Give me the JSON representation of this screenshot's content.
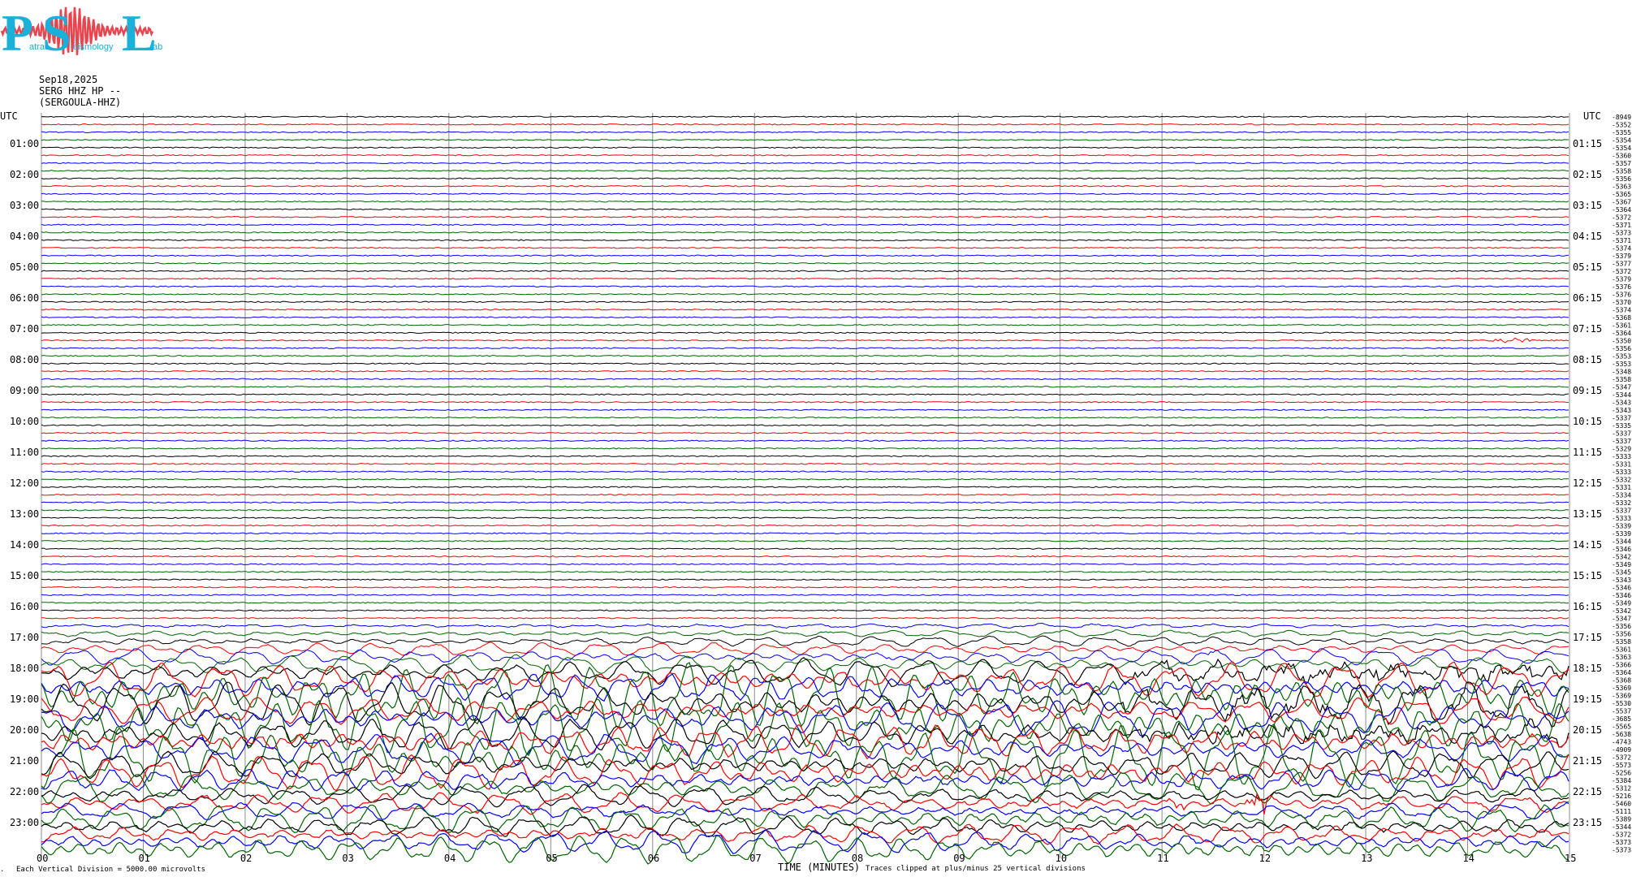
{
  "logo": {
    "letters": [
      "P",
      "S",
      "L"
    ],
    "words": [
      "atras",
      "eismology",
      "ab"
    ],
    "color": "#1ab0d8",
    "wave_color": "#e8454f"
  },
  "header": {
    "date": "Sep18,2025",
    "station": "SERG HHZ HP --",
    "channel": "(SERGOULA-HHZ)"
  },
  "left_axis_label": "UTC",
  "right_axis_label": "UTC",
  "footer": {
    "scale_note": "Each Vertical Division = 5000.00 microvolts",
    "clip_note": "Traces clipped at plus/minus 25 vertical divisions",
    "mark": "."
  },
  "chart_data": {
    "type": "line",
    "xlabel": "TIME (MINUTES)",
    "xlim": [
      0,
      15
    ],
    "x_ticks": [
      "00",
      "01",
      "02",
      "03",
      "04",
      "05",
      "06",
      "07",
      "08",
      "09",
      "10",
      "11",
      "12",
      "13",
      "14",
      "15"
    ],
    "left_ticks": [
      "01:00",
      "02:00",
      "03:00",
      "04:00",
      "05:00",
      "06:00",
      "07:00",
      "08:00",
      "09:00",
      "10:00",
      "11:00",
      "12:00",
      "13:00",
      "14:00",
      "15:00",
      "16:00",
      "17:00",
      "18:00",
      "19:00",
      "20:00",
      "21:00",
      "22:00",
      "23:00"
    ],
    "right_ticks": [
      "01:15",
      "02:15",
      "03:15",
      "04:15",
      "05:15",
      "06:15",
      "07:15",
      "08:15",
      "09:15",
      "10:15",
      "11:15",
      "12:15",
      "13:15",
      "14:15",
      "15:15",
      "16:15",
      "17:15",
      "18:15",
      "19:15",
      "20:15",
      "21:15",
      "22:15",
      "23:15"
    ],
    "trace_colors": [
      "#000000",
      "#ff0000",
      "#0000ff",
      "#006400"
    ],
    "trace_minutes": 15,
    "trace_count": 96,
    "trace_mean_counts": [
      "-8949",
      "-5352",
      "-5355",
      "-5354",
      "-5354",
      "-5360",
      "-5357",
      "-5358",
      "-5356",
      "-5363",
      "-5365",
      "-5367",
      "-5364",
      "-5372",
      "-5371",
      "-5373",
      "-5371",
      "-5374",
      "-5379",
      "-5377",
      "-5372",
      "-5379",
      "-5376",
      "-5376",
      "-5370",
      "-5374",
      "-5368",
      "-5361",
      "-5364",
      "-5350",
      "-5356",
      "-5353",
      "-5353",
      "-5348",
      "-5358",
      "-5347",
      "-5344",
      "-5343",
      "-5343",
      "-5337",
      "-5335",
      "-5337",
      "-5337",
      "-5329",
      "-5333",
      "-5331",
      "-5333",
      "-5332",
      "-5331",
      "-5334",
      "-5332",
      "-5337",
      "-5333",
      "-5339",
      "-5339",
      "-5344",
      "-5346",
      "-5342",
      "-5349",
      "-5345",
      "-5343",
      "-5346",
      "-5346",
      "-5349",
      "-5342",
      "-5347",
      "-5356",
      "-5356",
      "-5358",
      "-5361",
      "-5363",
      "-5366",
      "-5364",
      "-5368",
      "-5369",
      "-5369",
      "-5530",
      "-5537",
      "-3685",
      "-5565",
      "-5638",
      "-4743",
      "-4909",
      "-5372",
      "-5573",
      "-5256",
      "-5384",
      "-5312",
      "-5216",
      "-5460",
      "-5111",
      "-5389",
      "-5344",
      "-5372",
      "-5373",
      "-5373"
    ],
    "grid": true,
    "events": [
      {
        "trace": 29,
        "minute": 14.2,
        "duration": 0.5,
        "amplitude": 4
      },
      {
        "trace": 70,
        "minute": 8.3,
        "duration": 0.05,
        "amplitude": 6
      },
      {
        "trace": 70,
        "minute": 11.4,
        "duration": 0.3,
        "amplitude": 3
      },
      {
        "trace": 89,
        "minute": 11.0,
        "duration": 0.3,
        "amplitude": 4
      },
      {
        "trace": 89,
        "minute": 11.8,
        "duration": 0.3,
        "amplitude": 16
      }
    ]
  }
}
